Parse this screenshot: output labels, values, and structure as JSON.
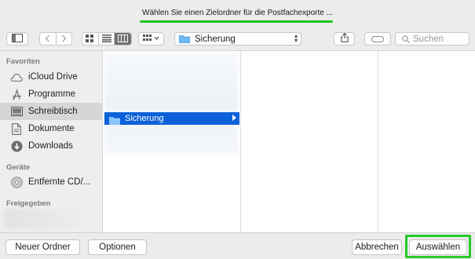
{
  "window": {
    "title": "Wählen Sie einen Zielordner für die Postfachexporte ..."
  },
  "toolbar": {
    "path_selector": {
      "label": "Sicherung"
    },
    "search": {
      "placeholder": "Suchen"
    },
    "icons": [
      "sidebar-toggle-icon",
      "back-icon",
      "forward-icon",
      "icon-view-icon",
      "list-view-icon",
      "column-view-icon",
      "group-icon",
      "share-icon",
      "tag-icon",
      "search-icon"
    ]
  },
  "sidebar": {
    "sections": [
      {
        "title": "Favoriten",
        "items": [
          {
            "label": "iCloud Drive",
            "icon": "cloud-icon"
          },
          {
            "label": "Programme",
            "icon": "apps-icon"
          },
          {
            "label": "Schreibtisch",
            "icon": "desktop-icon",
            "selected": true
          },
          {
            "label": "Dokumente",
            "icon": "document-icon"
          },
          {
            "label": "Downloads",
            "icon": "download-icon"
          }
        ]
      },
      {
        "title": "Geräte",
        "items": [
          {
            "label": "Entfernte CD/...",
            "icon": "disc-icon"
          }
        ]
      },
      {
        "title": "Freigegeben",
        "items": []
      }
    ]
  },
  "browser": {
    "selected_item": {
      "label": "Sicherung",
      "icon": "folder-icon"
    }
  },
  "footer": {
    "new_folder": "Neuer Ordner",
    "options": "Optionen",
    "cancel": "Abbrechen",
    "choose": "Auswählen"
  },
  "colors": {
    "selection": "#0c61d9",
    "highlight": "#27c92a",
    "window": "#ececec"
  }
}
